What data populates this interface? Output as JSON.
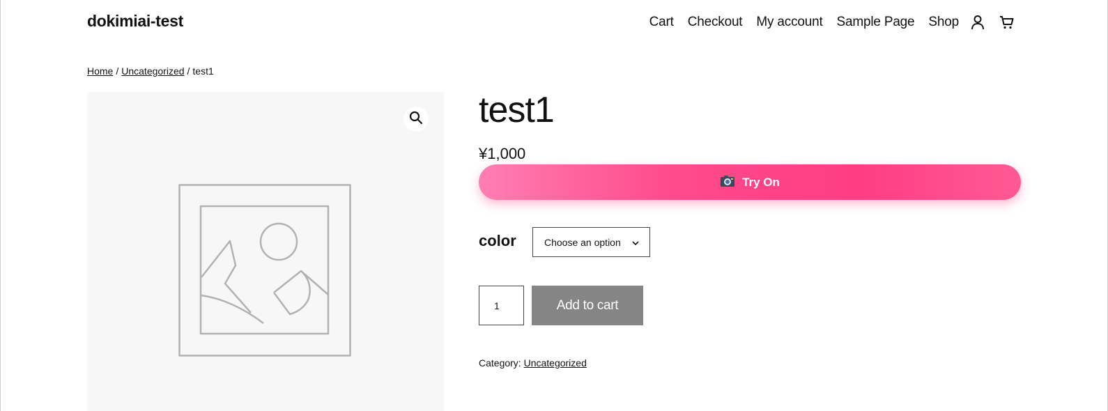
{
  "header": {
    "site_title": "dokimiai-test",
    "nav": [
      {
        "label": "Cart"
      },
      {
        "label": "Checkout"
      },
      {
        "label": "My account"
      },
      {
        "label": "Sample Page"
      },
      {
        "label": "Shop"
      }
    ],
    "icons": [
      "user-account-icon",
      "shopping-cart-icon"
    ]
  },
  "breadcrumb": {
    "home": "Home",
    "category": "Uncategorized",
    "current": "test1",
    "separator": "/"
  },
  "product": {
    "title": "test1",
    "price": "¥1,000",
    "try_on": {
      "label": "Try On",
      "icon": "camera-icon"
    },
    "variation": {
      "label": "color",
      "selected": "Choose an option"
    },
    "quantity": "1",
    "add_to_cart": "Add to cart",
    "meta": {
      "category_label": "Category:",
      "category_value": "Uncategorized"
    }
  },
  "colors": {
    "accent_pink": "#ff4b8b",
    "button_gray": "#858585",
    "gallery_bg": "#f6f7f6"
  }
}
